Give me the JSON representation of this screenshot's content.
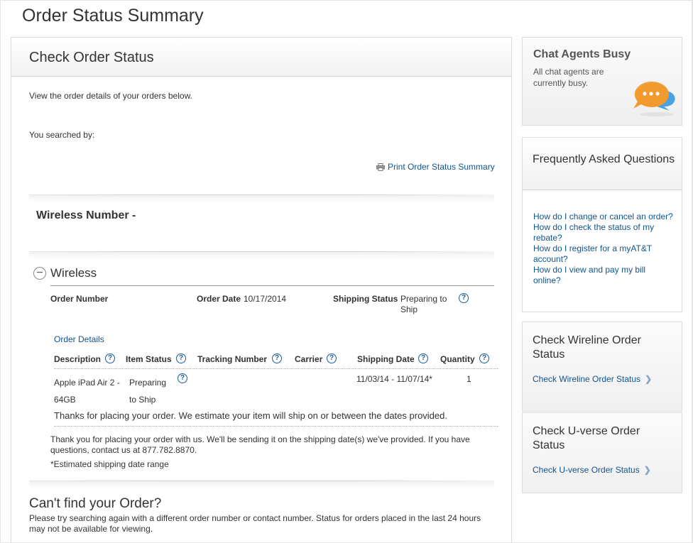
{
  "page_title": "Order Status Summary",
  "main": {
    "heading": "Check Order Status",
    "intro": "View the order details of your orders below.",
    "searched_by": "You searched by:",
    "print_link": "Print Order Status Summary",
    "wireless_number": "Wireless Number -",
    "section_label": "Wireless",
    "order_number_label": "Order Number",
    "order_date_label": "Order Date",
    "order_date": "10/17/2014",
    "shipping_status_label": "Shipping Status",
    "shipping_status_line1": "Preparing to",
    "shipping_status_line2": "Ship",
    "order_details_link": "Order Details",
    "columns": {
      "description": "Description",
      "item_status": "Item Status",
      "tracking_number": "Tracking Number",
      "carrier": "Carrier",
      "shipping_date": "Shipping Date",
      "quantity": "Quantity"
    },
    "item": {
      "description_line1": "Apple iPad Air 2 -",
      "description_line2": "64GB",
      "status_line1": "Preparing",
      "status_line2": "to Ship",
      "shipping_date": "11/03/14 - 11/07/14*",
      "quantity": "1"
    },
    "item_note": "Thanks for placing your order. We estimate your item will ship on or between the dates provided.",
    "thank_you": "Thank you for placing your order with us. We'll be sending it on the shipping date(s) we've provided. If you have questions, contact us at 877.782.8870.",
    "estimated_note": "*Estimated shipping date range",
    "cant_find_title": "Can't find your Order?",
    "cant_find_text": "Please try searching again with a different order number or contact number. Status for orders placed in the last 24 hours may not be available for viewing."
  },
  "sidebar": {
    "chat_title": "Chat Agents Busy",
    "chat_text": "All chat agents are currently busy.",
    "faq_title": "Frequently Asked Questions",
    "faq_items": [
      "How do I change or cancel an order?",
      "How do I check the status of my rebate?",
      "How do I register for a myAT&T account?",
      "How do I view and pay my bill online?"
    ],
    "wireline_title": "Check Wireline Order Status",
    "wireline_link": "Check Wireline Order Status",
    "uverse_title": "Check U-verse Order Status",
    "uverse_link": "Check U-verse Order Status"
  },
  "colors": {
    "link": "#0f5490",
    "help_icon": "#1a5d99",
    "chat_bubble_orange": "#f29a2e",
    "chat_bubble_blue": "#4aa3df"
  },
  "icons": {
    "print": "printer-icon",
    "help": "help-icon",
    "toggle": "collapse-icon",
    "chat": "chat-bubbles-icon",
    "chevron": "chevron-right-icon"
  }
}
